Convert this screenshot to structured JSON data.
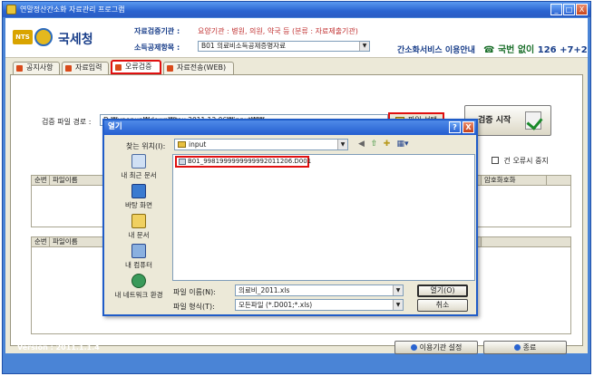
{
  "window": {
    "title": "연말정산간소화 자료관리 프로그램",
    "minimize": "_",
    "maximize": "□",
    "close": "X"
  },
  "header": {
    "logo_badge": "NTS",
    "agency": "국세청",
    "org_label": "자료검증기관 :",
    "org_value": "요양기관 : 병원, 의원, 약국 등 (분류 : 자료제출기관)",
    "type_label": "소득공제항목 :",
    "type_value": "B01 의료비소득공제증명자료",
    "service_info": "간소화서비스 이용안내",
    "phone_label": "국번 없이",
    "phone_number": "126 +7+2"
  },
  "tabs": [
    {
      "label": "공지사항"
    },
    {
      "label": "자료입력"
    },
    {
      "label": "오류검증"
    },
    {
      "label": "자료전송(WEB)"
    }
  ],
  "verify": {
    "path_label": "검증 파일 경로 :",
    "path_value": "D:₩xpopup₩down₩tax.2011.12.06₩input₩₩",
    "pick_label": "파일 선택",
    "start_label": "검증 시작",
    "error_check_label": "건 오류시 중지"
  },
  "grid_top": {
    "col_no": "순번",
    "col_file": "파일이름",
    "col_crypto": "암호화호화"
  },
  "grid_bottom": {
    "col_no": "순번",
    "col_file": "파일이름"
  },
  "footer": {
    "version": "Version : 2011.1.1.4",
    "org_setup": "이용기관 설정",
    "exit": "종료"
  },
  "dialog": {
    "title": "열기",
    "help": "?",
    "close": "X",
    "look_in_label": "찾는 위치(I):",
    "look_in_value": "input",
    "places": [
      {
        "label": "내 최근 문서"
      },
      {
        "label": "바탕 화면"
      },
      {
        "label": "내 문서"
      },
      {
        "label": "내 컴퓨터"
      },
      {
        "label": "내 네트워크 환경"
      }
    ],
    "files": [
      "B01_9981999999999992011206.D001"
    ],
    "filename_label": "파일 이름(N):",
    "filename_value": "의료비_2011.xls",
    "filetype_label": "파일 형식(T):",
    "filetype_value": "모든파일 (*.D001;*.xls)",
    "open_label": "열기(O)",
    "cancel_label": "취소"
  }
}
